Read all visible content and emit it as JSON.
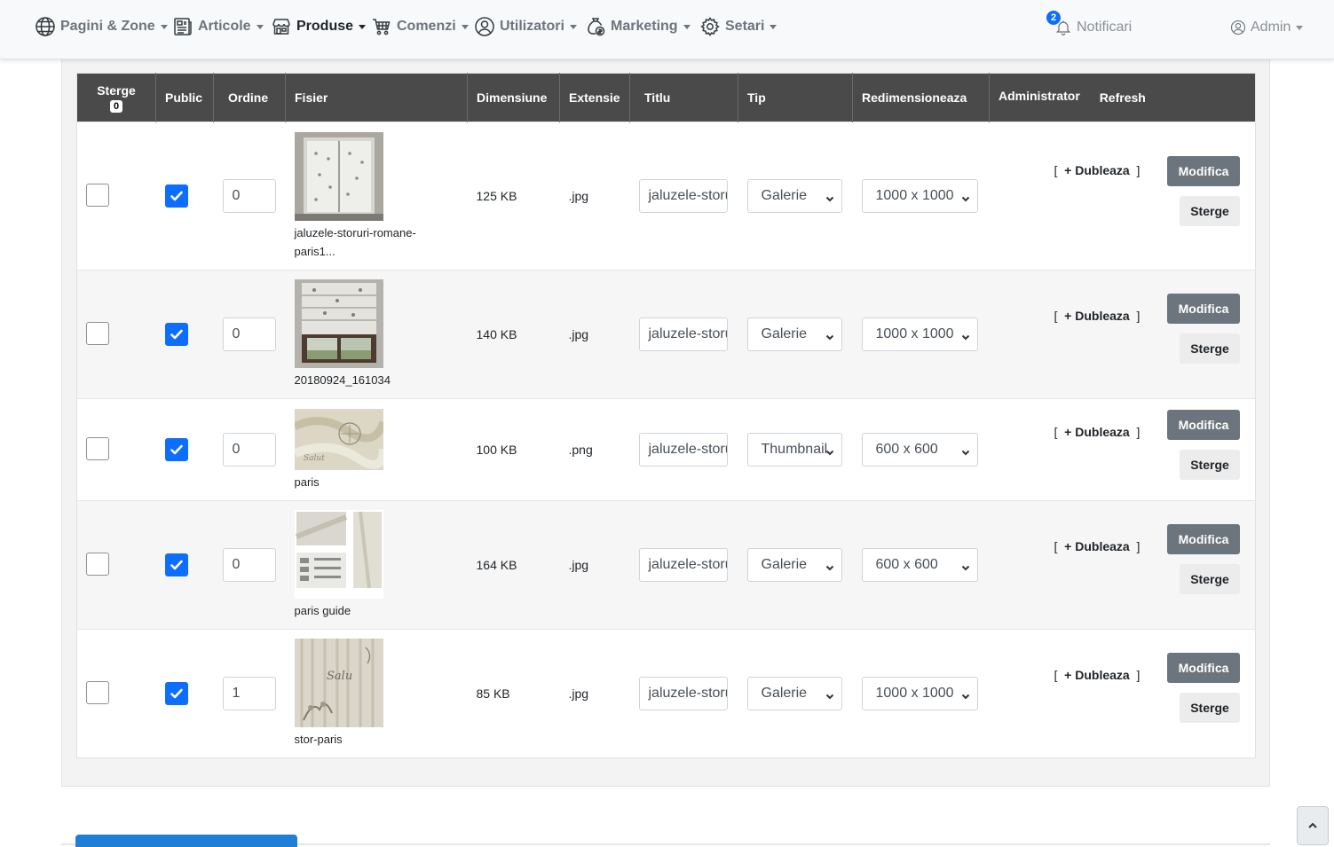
{
  "nav": {
    "items": [
      {
        "label": "Pagini & Zone",
        "icon": "globe-icon",
        "active": false
      },
      {
        "label": "Articole",
        "icon": "newspaper-icon",
        "active": false
      },
      {
        "label": "Produse",
        "icon": "shop-icon",
        "active": true
      },
      {
        "label": "Comenzi",
        "icon": "cart-icon",
        "active": false
      },
      {
        "label": "Utilizatori",
        "icon": "user-circle-icon",
        "active": false
      },
      {
        "label": "Marketing",
        "icon": "money-bag-icon",
        "active": false
      },
      {
        "label": "Setari",
        "icon": "gear-icon",
        "active": false
      }
    ],
    "notifications": {
      "label": "Notificari",
      "count": "2",
      "icon": "bell-icon"
    },
    "account": {
      "label": "Admin",
      "icon": "person-circle-icon"
    }
  },
  "table": {
    "headers": {
      "sterge": "Sterge",
      "sterge_count": "0",
      "public": "Public",
      "ordine": "Ordine",
      "fisier": "Fisier",
      "dimensiune": "Dimensiune",
      "extensie": "Extensie",
      "titlu": "Titlu",
      "tip": "Tip",
      "redimensioneaza": "Redimensioneaza",
      "administrator": "Administrator",
      "refresh": "Refresh"
    },
    "rows": [
      {
        "delete_checked": false,
        "public_checked": true,
        "order": "0",
        "filename": "jaluzele-storuri-romane-paris1...",
        "size": "125 KB",
        "ext": ".jpg",
        "title": "jaluzele-storuri",
        "type": "Galerie",
        "resize": "1000 x 1000",
        "duplicate": "+ Dubleaza",
        "edit": "Modifica",
        "delete": "Sterge"
      },
      {
        "delete_checked": false,
        "public_checked": true,
        "order": "0",
        "filename": "20180924_161034",
        "size": "140 KB",
        "ext": ".jpg",
        "title": "jaluzele-storuri",
        "type": "Galerie",
        "resize": "1000 x 1000",
        "duplicate": "+ Dubleaza",
        "edit": "Modifica",
        "delete": "Sterge"
      },
      {
        "delete_checked": false,
        "public_checked": true,
        "order": "0",
        "filename": "paris",
        "size": "100 KB",
        "ext": ".png",
        "title": "jaluzele-storuri",
        "type": "Thumbnail",
        "resize": "600 x 600",
        "duplicate": "+ Dubleaza",
        "edit": "Modifica",
        "delete": "Sterge"
      },
      {
        "delete_checked": false,
        "public_checked": true,
        "order": "0",
        "filename": "paris guide",
        "size": "164 KB",
        "ext": ".jpg",
        "title": "jaluzele-storuri",
        "type": "Galerie",
        "resize": "600 x 600",
        "duplicate": "+ Dubleaza",
        "edit": "Modifica",
        "delete": "Sterge"
      },
      {
        "delete_checked": false,
        "public_checked": true,
        "order": "1",
        "filename": "stor-paris",
        "size": "85 KB",
        "ext": ".jpg",
        "title": "jaluzele-storuri",
        "type": "Galerie",
        "resize": "1000 x 1000",
        "duplicate": "+ Dubleaza",
        "edit": "Modifica",
        "delete": "Sterge"
      }
    ]
  },
  "colors": {
    "header_bg": "#4a4a4a",
    "checkbox_blue": "#0d6efd",
    "edit_button": "#6c757d",
    "bottom_tab_blue": "#1f7ed6"
  }
}
